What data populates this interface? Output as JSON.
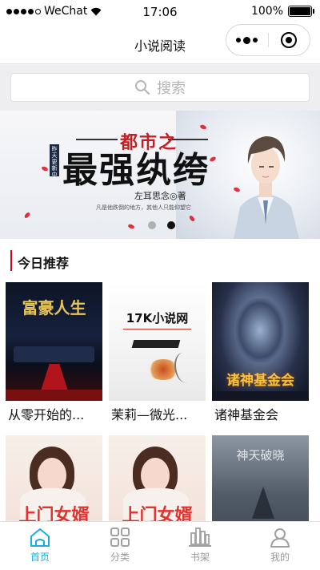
{
  "status_bar": {
    "carrier": "WeChat",
    "time": "17:06",
    "battery": "100%",
    "battery_level": 1.0
  },
  "navbar": {
    "title": "小说阅读",
    "more_icon": "more-dots-icon",
    "close_icon": "target-ring-icon"
  },
  "search": {
    "placeholder": "搜索",
    "icon": "search-icon"
  },
  "banner": {
    "subtitle": "都市之",
    "title": "最强纨绔",
    "tag": "昨天更新中",
    "author": "左耳思念◎著",
    "tagline": "凡是他跌倒的地方，其他人只能仰望它",
    "pager": {
      "count": 2,
      "active": 1
    }
  },
  "section": {
    "title": "今日推荐"
  },
  "books": [
    {
      "title": "从零开始的...",
      "cover_text": "富豪人生"
    },
    {
      "title": "茉莉—微光...",
      "cover_text": "17K小说网"
    },
    {
      "title": "诸神基金会",
      "cover_text": "诸神基金会"
    },
    {
      "title": "",
      "cover_text": "上门女婿"
    },
    {
      "title": "",
      "cover_text": "上门女婿"
    },
    {
      "title": "",
      "cover_text": "神天破晓"
    }
  ],
  "tabs": [
    {
      "label": "首页",
      "icon": "home-icon",
      "active": true
    },
    {
      "label": "分类",
      "icon": "grid-icon",
      "active": false
    },
    {
      "label": "书架",
      "icon": "bookshelf-icon",
      "active": false
    },
    {
      "label": "我的",
      "icon": "user-icon",
      "active": false
    }
  ],
  "colors": {
    "accent": "#1aade2",
    "section_bar": "#d0021b",
    "banner_red": "#c41d23"
  }
}
